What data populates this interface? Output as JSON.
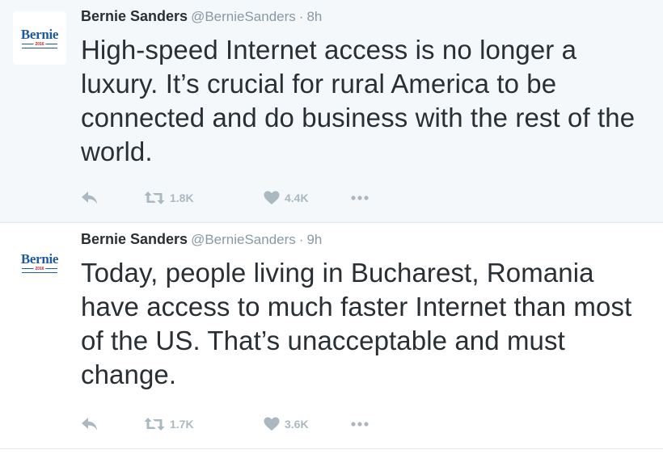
{
  "tweets": [
    {
      "avatar": {
        "logo": "Bernie",
        "year": "2016"
      },
      "name": "Bernie Sanders",
      "handle": "@BernieSanders",
      "separator": "·",
      "time": "8h",
      "text": "High-speed Internet access is no longer a luxury. It’s crucial for rural America to be connected and do business with the rest of the world.",
      "retweets": "1.8K",
      "likes": "4.4K",
      "icons": [
        "reply-icon",
        "retweet-icon",
        "heart-icon",
        "more-icon"
      ]
    },
    {
      "avatar": {
        "logo": "Bernie",
        "year": "2016"
      },
      "name": "Bernie Sanders",
      "handle": "@BernieSanders",
      "separator": "·",
      "time": "9h",
      "text": "Today, people living in Bucharest, Romania have access to much faster Internet than most of the US. That’s unacceptable and must change.",
      "retweets": "1.7K",
      "likes": "3.6K",
      "icons": [
        "reply-icon",
        "retweet-icon",
        "heart-icon",
        "more-icon"
      ]
    }
  ],
  "colors": {
    "highlight_background": "#f5f8fa",
    "text": "#292f33",
    "meta": "#8899a6",
    "action": "#aab8c2",
    "logo": "#1f5a9e"
  }
}
